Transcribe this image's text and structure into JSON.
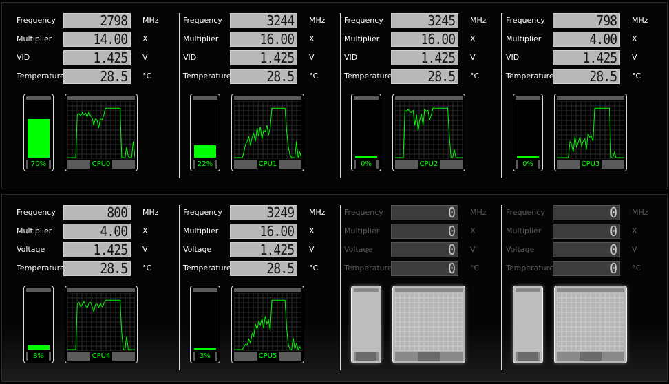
{
  "labels": {
    "frequency": "Frequency",
    "multiplier": "Multiplier",
    "vid": "VID",
    "voltage": "Voltage",
    "temperature": "Temperature"
  },
  "units": {
    "freq": "MHz",
    "mult": "X",
    "volt": "V",
    "temp": "°C"
  },
  "colors": {
    "accent": "#00ff00",
    "lcd": "#b8b8b8",
    "disabled_lcd": "#3c3c3c"
  },
  "cpus": [
    {
      "name": "CPU0",
      "frequency": "2798",
      "multiplier": "14.00",
      "voltage": "1.425",
      "temperature": "28.5",
      "load_percent": "70%",
      "load": 70,
      "enabled": true
    },
    {
      "name": "CPU1",
      "frequency": "3244",
      "multiplier": "16.00",
      "voltage": "1.425",
      "temperature": "28.5",
      "load_percent": "22%",
      "load": 22,
      "enabled": true
    },
    {
      "name": "CPU2",
      "frequency": "3245",
      "multiplier": "16.00",
      "voltage": "1.425",
      "temperature": "28.5",
      "load_percent": "0%",
      "load": 0,
      "enabled": true
    },
    {
      "name": "CPU3",
      "frequency": "798",
      "multiplier": "4.00",
      "voltage": "1.425",
      "temperature": "28.5",
      "load_percent": "0%",
      "load": 0,
      "enabled": true
    },
    {
      "name": "CPU4",
      "frequency": "800",
      "multiplier": "4.00",
      "voltage": "1.425",
      "temperature": "28.5",
      "load_percent": "8%",
      "load": 8,
      "enabled": true
    },
    {
      "name": "CPU5",
      "frequency": "3249",
      "multiplier": "16.00",
      "voltage": "1.425",
      "temperature": "28.5",
      "load_percent": "3%",
      "load": 3,
      "enabled": true
    },
    {
      "name": "",
      "frequency": "0",
      "multiplier": "0",
      "voltage": "0",
      "temperature": "0",
      "load_percent": "",
      "load": 0,
      "enabled": false
    },
    {
      "name": "",
      "frequency": "0",
      "multiplier": "0",
      "voltage": "0",
      "temperature": "0",
      "load_percent": "",
      "load": 0,
      "enabled": false
    }
  ],
  "history": [
    [
      0,
      0,
      0,
      0,
      0,
      0,
      80,
      82,
      78,
      84,
      80,
      83,
      76,
      85,
      78,
      74,
      60,
      72,
      70,
      55,
      72,
      70,
      78,
      92,
      92,
      92,
      92,
      92,
      92,
      92,
      92,
      92,
      92,
      0,
      0,
      0,
      20,
      2,
      0,
      0,
      30,
      0
    ],
    [
      0,
      0,
      0,
      0,
      0,
      0,
      10,
      25,
      30,
      40,
      22,
      38,
      45,
      30,
      55,
      40,
      58,
      35,
      50,
      48,
      60,
      42,
      55,
      92,
      92,
      92,
      92,
      92,
      92,
      92,
      92,
      92,
      50,
      20,
      5,
      0,
      0,
      0,
      30,
      0,
      10,
      0
    ],
    [
      0,
      0,
      0,
      0,
      0,
      0,
      88,
      86,
      90,
      85,
      84,
      88,
      60,
      80,
      50,
      70,
      82,
      60,
      90,
      86,
      88,
      70,
      80,
      92,
      92,
      92,
      92,
      92,
      92,
      92,
      92,
      92,
      92,
      40,
      0,
      0,
      15,
      0,
      0,
      0,
      0,
      0
    ],
    [
      0,
      0,
      0,
      0,
      0,
      0,
      0,
      0,
      30,
      25,
      10,
      40,
      20,
      28,
      38,
      22,
      30,
      35,
      15,
      45,
      38,
      40,
      30,
      92,
      92,
      92,
      92,
      92,
      92,
      92,
      92,
      92,
      92,
      0,
      0,
      10,
      0,
      0,
      0,
      0,
      0,
      0
    ],
    [
      0,
      0,
      0,
      0,
      0,
      0,
      85,
      88,
      80,
      84,
      90,
      82,
      78,
      86,
      88,
      80,
      70,
      84,
      85,
      78,
      86,
      80,
      84,
      92,
      92,
      92,
      92,
      92,
      92,
      92,
      92,
      92,
      92,
      30,
      0,
      0,
      25,
      0,
      0,
      0,
      0,
      0
    ],
    [
      0,
      0,
      0,
      0,
      0,
      0,
      5,
      10,
      8,
      20,
      12,
      30,
      25,
      48,
      38,
      52,
      46,
      58,
      40,
      62,
      48,
      55,
      35,
      92,
      92,
      92,
      92,
      92,
      92,
      92,
      92,
      92,
      40,
      10,
      0,
      0,
      22,
      0,
      12,
      0,
      5,
      0
    ]
  ]
}
